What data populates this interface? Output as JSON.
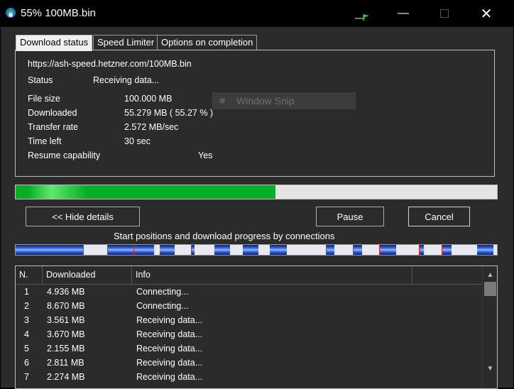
{
  "window": {
    "title": "55% 100MB.bin"
  },
  "tabs": [
    {
      "label": "Download status"
    },
    {
      "label": "Speed Limiter"
    },
    {
      "label": "Options on completion"
    }
  ],
  "status": {
    "url": "https://ash-speed.hetzner.com/100MB.bin",
    "status_label": "Status",
    "status_value": "Receiving data...",
    "file_size_label": "File size",
    "file_size_value": "100.000  MB",
    "downloaded_label": "Downloaded",
    "downloaded_value": "55.279  MB  ( 55.27 % )",
    "rate_label": "Transfer rate",
    "rate_value": "2.572  MB/sec",
    "time_left_label": "Time left",
    "time_left_value": "30 sec",
    "resume_label": "Resume capability",
    "resume_value": "Yes"
  },
  "overlay": {
    "ghost_text": "Window Snip"
  },
  "progress": {
    "fraction": 0.5527,
    "color": "#06b025"
  },
  "buttons": {
    "hide_details": "<< Hide details",
    "pause": "Pause",
    "cancel": "Cancel"
  },
  "connections": {
    "label": "Start positions and download progress by connections",
    "segments": [
      [
        0.0,
        0.14
      ],
      [
        0.19,
        0.245
      ],
      [
        0.245,
        0.288
      ],
      [
        0.3,
        0.33
      ],
      [
        0.364,
        0.371
      ],
      [
        0.413,
        0.445
      ],
      [
        0.472,
        0.505
      ],
      [
        0.528,
        0.563
      ],
      [
        0.645,
        0.662
      ],
      [
        0.7,
        0.72
      ],
      [
        0.755,
        0.79
      ],
      [
        0.838,
        0.848
      ],
      [
        0.885,
        0.905
      ],
      [
        0.958,
        0.992
      ]
    ],
    "markers": [
      0.14,
      0.19,
      0.245,
      0.364,
      0.645,
      0.7,
      0.755,
      0.838,
      0.885
    ]
  },
  "table": {
    "headers": [
      "N.",
      "Downloaded",
      "Info"
    ],
    "rows": [
      [
        "1",
        "4.936  MB",
        "Connecting..."
      ],
      [
        "2",
        "8.670  MB",
        "Connecting..."
      ],
      [
        "3",
        "3.561  MB",
        "Receiving data..."
      ],
      [
        "4",
        "3.670  MB",
        "Receiving data..."
      ],
      [
        "5",
        "2.155  MB",
        "Receiving data..."
      ],
      [
        "6",
        "2.811  MB",
        "Receiving data..."
      ],
      [
        "7",
        "2.274  MB",
        "Receiving data..."
      ]
    ]
  }
}
